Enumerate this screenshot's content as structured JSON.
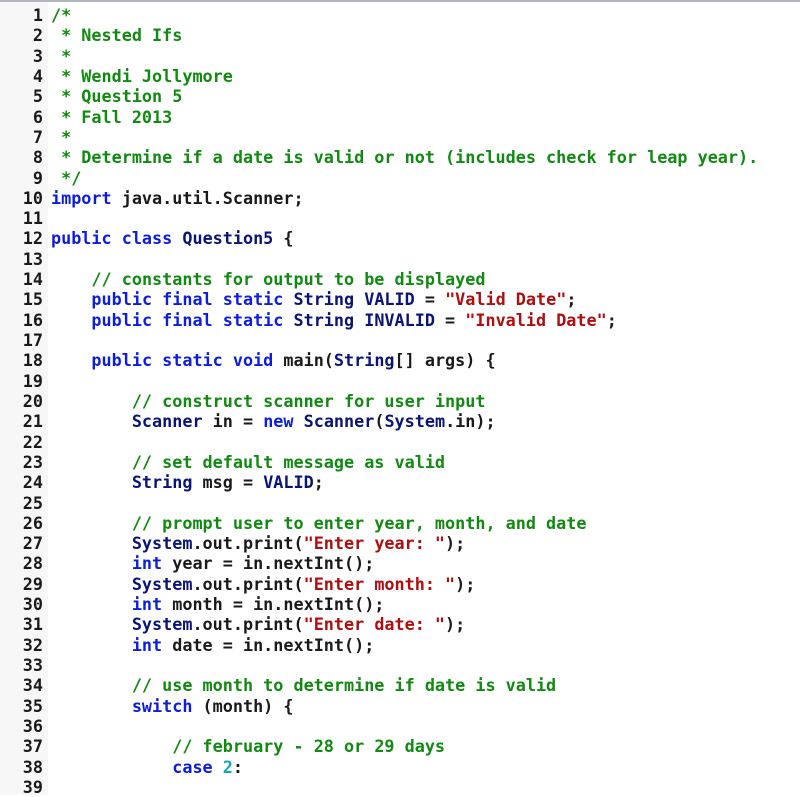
{
  "editor": {
    "language": "java",
    "colors": {
      "comment": "#108a10",
      "keyword": "#0b1de0",
      "type": "#0a1478",
      "string": "#b00d0d",
      "number": "#11a8bb",
      "plain": "#1a1a1a"
    },
    "lines": [
      {
        "n": "1",
        "tokens": [
          [
            "comment",
            "/*"
          ]
        ]
      },
      {
        "n": "2",
        "tokens": [
          [
            "comment",
            " * Nested Ifs"
          ]
        ]
      },
      {
        "n": "3",
        "tokens": [
          [
            "comment",
            " *"
          ]
        ]
      },
      {
        "n": "4",
        "tokens": [
          [
            "comment",
            " * Wendi Jollymore"
          ]
        ]
      },
      {
        "n": "5",
        "tokens": [
          [
            "comment",
            " * Question 5"
          ]
        ]
      },
      {
        "n": "6",
        "tokens": [
          [
            "comment",
            " * Fall 2013"
          ]
        ]
      },
      {
        "n": "7",
        "tokens": [
          [
            "comment",
            " *"
          ]
        ]
      },
      {
        "n": "8",
        "tokens": [
          [
            "comment",
            " * Determine if a date is valid or not (includes check for leap year)."
          ]
        ]
      },
      {
        "n": "9",
        "tokens": [
          [
            "comment",
            " */"
          ]
        ]
      },
      {
        "n": "10",
        "tokens": [
          [
            "keyword",
            "import"
          ],
          [
            "plain",
            " java.util.Scanner;"
          ]
        ]
      },
      {
        "n": "11",
        "tokens": []
      },
      {
        "n": "12",
        "tokens": [
          [
            "keyword",
            "public class"
          ],
          [
            "plain",
            " "
          ],
          [
            "type",
            "Question5"
          ],
          [
            "plain",
            " {"
          ]
        ]
      },
      {
        "n": "13",
        "tokens": []
      },
      {
        "n": "14",
        "tokens": [
          [
            "plain",
            "    "
          ],
          [
            "comment",
            "// constants for output to be displayed"
          ]
        ]
      },
      {
        "n": "15",
        "tokens": [
          [
            "plain",
            "    "
          ],
          [
            "keyword",
            "public final static"
          ],
          [
            "plain",
            " "
          ],
          [
            "type",
            "String VALID"
          ],
          [
            "plain",
            " = "
          ],
          [
            "string",
            "\"Valid Date\""
          ],
          [
            "plain",
            ";"
          ]
        ]
      },
      {
        "n": "16",
        "tokens": [
          [
            "plain",
            "    "
          ],
          [
            "keyword",
            "public final static"
          ],
          [
            "plain",
            " "
          ],
          [
            "type",
            "String INVALID"
          ],
          [
            "plain",
            " = "
          ],
          [
            "string",
            "\"Invalid Date\""
          ],
          [
            "plain",
            ";"
          ]
        ]
      },
      {
        "n": "17",
        "tokens": []
      },
      {
        "n": "18",
        "tokens": [
          [
            "plain",
            "    "
          ],
          [
            "keyword",
            "public static void"
          ],
          [
            "plain",
            " main("
          ],
          [
            "type",
            "String"
          ],
          [
            "plain",
            "[] args) {"
          ]
        ]
      },
      {
        "n": "19",
        "tokens": []
      },
      {
        "n": "20",
        "tokens": [
          [
            "plain",
            "        "
          ],
          [
            "comment",
            "// construct scanner for user input"
          ]
        ]
      },
      {
        "n": "21",
        "tokens": [
          [
            "plain",
            "        "
          ],
          [
            "type",
            "Scanner"
          ],
          [
            "plain",
            " in = "
          ],
          [
            "keyword",
            "new"
          ],
          [
            "plain",
            " "
          ],
          [
            "type",
            "Scanner"
          ],
          [
            "plain",
            "("
          ],
          [
            "type",
            "System"
          ],
          [
            "plain",
            ".in);"
          ]
        ]
      },
      {
        "n": "22",
        "tokens": []
      },
      {
        "n": "23",
        "tokens": [
          [
            "plain",
            "        "
          ],
          [
            "comment",
            "// set default message as valid"
          ]
        ]
      },
      {
        "n": "24",
        "tokens": [
          [
            "plain",
            "        "
          ],
          [
            "type",
            "String"
          ],
          [
            "plain",
            " msg = "
          ],
          [
            "type",
            "VALID"
          ],
          [
            "plain",
            ";"
          ]
        ]
      },
      {
        "n": "25",
        "tokens": []
      },
      {
        "n": "26",
        "tokens": [
          [
            "plain",
            "        "
          ],
          [
            "comment",
            "// prompt user to enter year, month, and date"
          ]
        ]
      },
      {
        "n": "27",
        "tokens": [
          [
            "plain",
            "        "
          ],
          [
            "type",
            "System"
          ],
          [
            "plain",
            ".out.print("
          ],
          [
            "string",
            "\"Enter year: \""
          ],
          [
            "plain",
            ");"
          ]
        ]
      },
      {
        "n": "28",
        "tokens": [
          [
            "plain",
            "        "
          ],
          [
            "keyword",
            "int"
          ],
          [
            "plain",
            " year = in.nextInt();"
          ]
        ]
      },
      {
        "n": "29",
        "tokens": [
          [
            "plain",
            "        "
          ],
          [
            "type",
            "System"
          ],
          [
            "plain",
            ".out.print("
          ],
          [
            "string",
            "\"Enter month: \""
          ],
          [
            "plain",
            ");"
          ]
        ]
      },
      {
        "n": "30",
        "tokens": [
          [
            "plain",
            "        "
          ],
          [
            "keyword",
            "int"
          ],
          [
            "plain",
            " month = in.nextInt();"
          ]
        ]
      },
      {
        "n": "31",
        "tokens": [
          [
            "plain",
            "        "
          ],
          [
            "type",
            "System"
          ],
          [
            "plain",
            ".out.print("
          ],
          [
            "string",
            "\"Enter date: \""
          ],
          [
            "plain",
            ");"
          ]
        ]
      },
      {
        "n": "32",
        "tokens": [
          [
            "plain",
            "        "
          ],
          [
            "keyword",
            "int"
          ],
          [
            "plain",
            " date = in.nextInt();"
          ]
        ]
      },
      {
        "n": "33",
        "tokens": []
      },
      {
        "n": "34",
        "tokens": [
          [
            "plain",
            "        "
          ],
          [
            "comment",
            "// use month to determine if date is valid"
          ]
        ]
      },
      {
        "n": "35",
        "tokens": [
          [
            "plain",
            "        "
          ],
          [
            "keyword",
            "switch"
          ],
          [
            "plain",
            " (month) {"
          ]
        ]
      },
      {
        "n": "36",
        "tokens": []
      },
      {
        "n": "37",
        "tokens": [
          [
            "plain",
            "            "
          ],
          [
            "comment",
            "// february - 28 or 29 days"
          ]
        ]
      },
      {
        "n": "38",
        "tokens": [
          [
            "plain",
            "            "
          ],
          [
            "keyword",
            "case"
          ],
          [
            "plain",
            " "
          ],
          [
            "number",
            "2"
          ],
          [
            "plain",
            ":"
          ]
        ]
      },
      {
        "n": "39",
        "tokens": []
      }
    ]
  }
}
